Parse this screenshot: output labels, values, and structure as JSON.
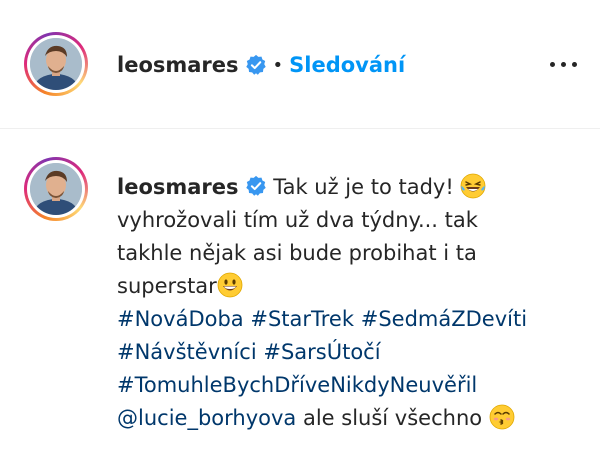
{
  "post": {
    "username": "leosmares",
    "separator": "•",
    "follow_label": "Sledování",
    "more_label": "more-options"
  },
  "caption": {
    "username": "leosmares",
    "text_1": "Tak už je to tady!",
    "text_2": "vyhrožovali tím už dva týdny... tak",
    "text_3": "takhle nějak asi bude probihat i ta",
    "text_4": "superstar",
    "hashtags": [
      "#NováDoba",
      "#StarTrek",
      "#SedmáZDevíti",
      "#Návštěvníci",
      "#SarsÚtočí",
      "#TomuhleBychDříveNikdyNeuvěřil"
    ],
    "mention": "@lucie_borhyova",
    "text_5": "ale sluší všechno"
  },
  "colors": {
    "follow": "#0095f6",
    "link": "#00376b",
    "verified": "#3897f0",
    "emoji": "#ffcc33"
  }
}
